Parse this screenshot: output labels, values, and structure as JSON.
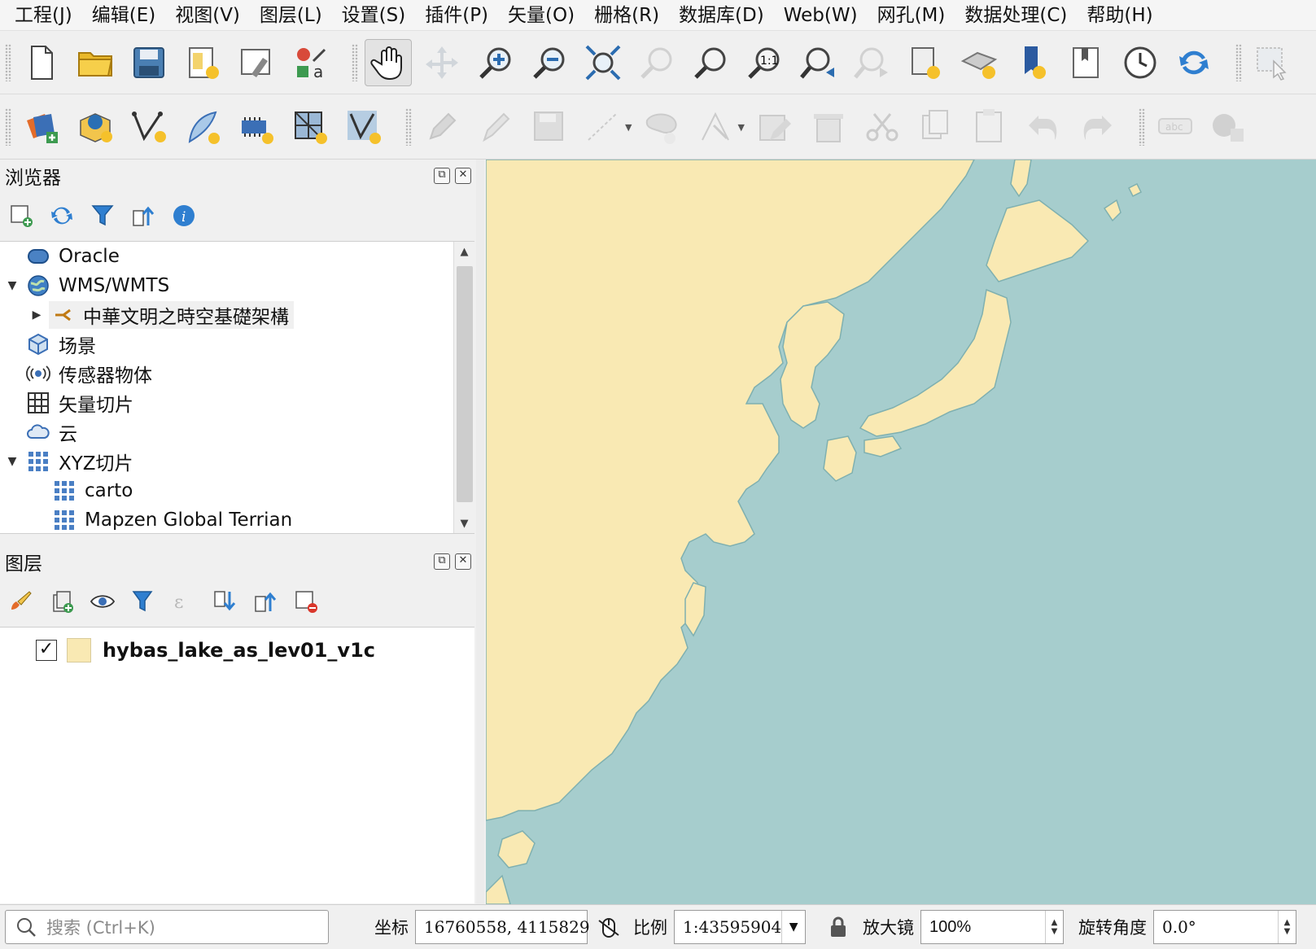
{
  "menu": [
    "工程(J)",
    "编辑(E)",
    "视图(V)",
    "图层(L)",
    "设置(S)",
    "插件(P)",
    "矢量(O)",
    "栅格(R)",
    "数据库(D)",
    "Web(W)",
    "网孔(M)",
    "数据处理(C)",
    "帮助(H)"
  ],
  "browser": {
    "title": "浏览器",
    "items": [
      {
        "label": "Oracle",
        "icon": "database-icon",
        "arrow": ""
      },
      {
        "label": "WMS/WMTS",
        "icon": "globe-icon",
        "arrow": "▼"
      },
      {
        "label": "中華文明之時空基礎架構",
        "icon": "wms-layer-icon",
        "arrow": "▶"
      },
      {
        "label": "场景",
        "icon": "cube-icon",
        "arrow": ""
      },
      {
        "label": "传感器物体",
        "icon": "sensor-icon",
        "arrow": ""
      },
      {
        "label": "矢量切片",
        "icon": "grid-icon",
        "arrow": ""
      },
      {
        "label": "云",
        "icon": "cloud-icon",
        "arrow": ""
      },
      {
        "label": "XYZ切片",
        "icon": "tiles-icon",
        "arrow": "▼"
      },
      {
        "label": "carto",
        "icon": "tiles-icon",
        "arrow": ""
      },
      {
        "label": "Mapzen Global Terrian",
        "icon": "tiles-icon",
        "arrow": ""
      }
    ]
  },
  "layers_panel": {
    "title": "图层",
    "layers": [
      {
        "name": "hybas_lake_as_lev01_v1c",
        "checked": "✓",
        "color": "#f9e9b3"
      }
    ]
  },
  "map": {
    "land_color": "#f9e9b3",
    "water_color": "#a6cdcd"
  },
  "status": {
    "search_placeholder": "搜索 (Ctrl+K)",
    "coord_label": "坐标",
    "coord_value": "16760558, 4115829",
    "scale_label": "比例",
    "scale_value": "1:43595904",
    "magnifier_label": "放大镜",
    "magnifier_value": "100%",
    "rotation_label": "旋转角度",
    "rotation_value": "0.0°"
  }
}
